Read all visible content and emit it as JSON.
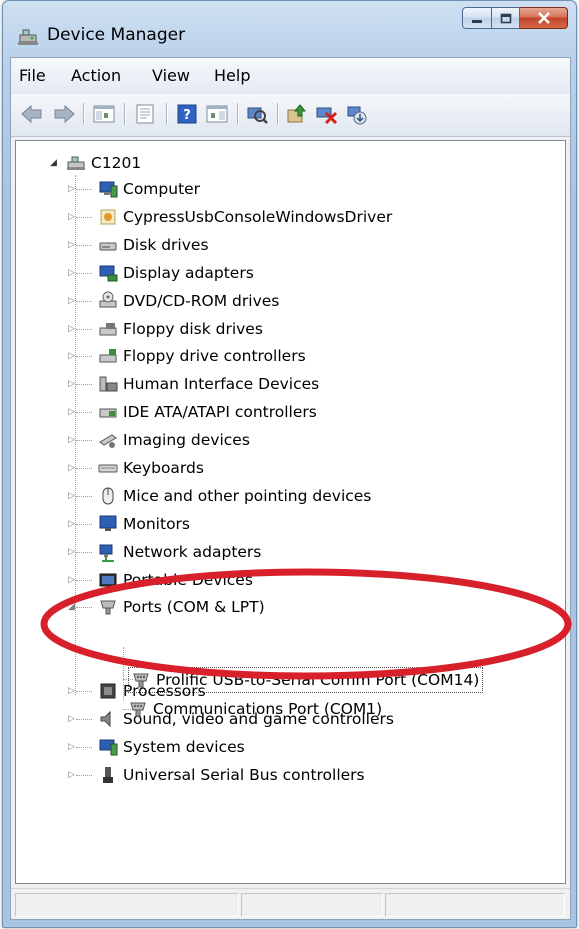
{
  "window": {
    "title": "Device Manager"
  },
  "menu": {
    "file": "File",
    "action": "Action",
    "view": "View",
    "help": "Help"
  },
  "toolbar": {
    "buttons": [
      "back-icon",
      "forward-icon",
      "show-hide-console-tree-icon",
      "properties-icon",
      "help-icon",
      "action-pane-icon",
      "scan-hardware-icon",
      "update-driver-icon",
      "disable-device-icon",
      "uninstall-device-icon"
    ]
  },
  "tree": {
    "root": "C1201",
    "categories": [
      "Computer",
      "CypressUsbConsoleWindowsDriver",
      "Disk drives",
      "Display adapters",
      "DVD/CD-ROM drives",
      "Floppy disk drives",
      "Floppy drive controllers",
      "Human Interface Devices",
      "IDE ATA/ATAPI controllers",
      "Imaging devices",
      "Keyboards",
      "Mice and other pointing devices",
      "Monitors",
      "Network adapters",
      "Portable Devices",
      "Ports (COM & LPT)"
    ],
    "ports_children": [
      "Prolific USB-to-Serial Comm Port (COM14)",
      "Communications Port (COM1)"
    ],
    "categories_after": [
      "Processors",
      "Sound, video and game controllers",
      "System devices",
      "Universal Serial Bus controllers"
    ]
  },
  "annotation": {
    "color": "#d8202a"
  }
}
